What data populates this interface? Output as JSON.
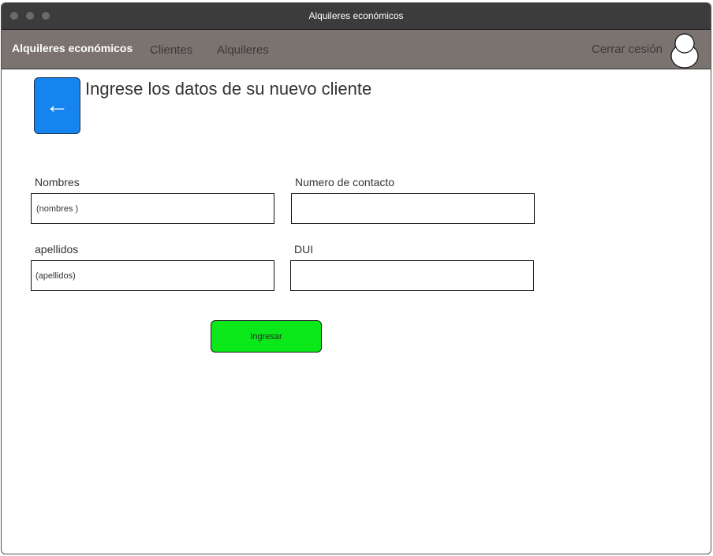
{
  "window": {
    "title": "Alquileres económicos"
  },
  "nav": {
    "brand": "Alquileres económicos",
    "links": [
      "Clientes",
      "Alquileres"
    ],
    "logout": "Cerrar cesión"
  },
  "page": {
    "title": "Ingrese los datos de su nuevo cliente",
    "back_symbol": "←"
  },
  "form": {
    "nombres": {
      "label": "Nombres",
      "placeholder": "(nombres )"
    },
    "numero_contacto": {
      "label": "Numero de contacto",
      "placeholder": ""
    },
    "apellidos": {
      "label": "apellidos",
      "placeholder": "(apellidos)"
    },
    "dui": {
      "label": "DUI",
      "placeholder": ""
    },
    "submit": "Ingresar"
  },
  "colors": {
    "titlebar": "#3c3c3c",
    "navbar": "#7a7370",
    "back_button": "#1584ee",
    "submit_button": "#0ae81a"
  },
  "icons": {
    "back": "arrow-left-icon",
    "avatar": "user-avatar-icon"
  }
}
